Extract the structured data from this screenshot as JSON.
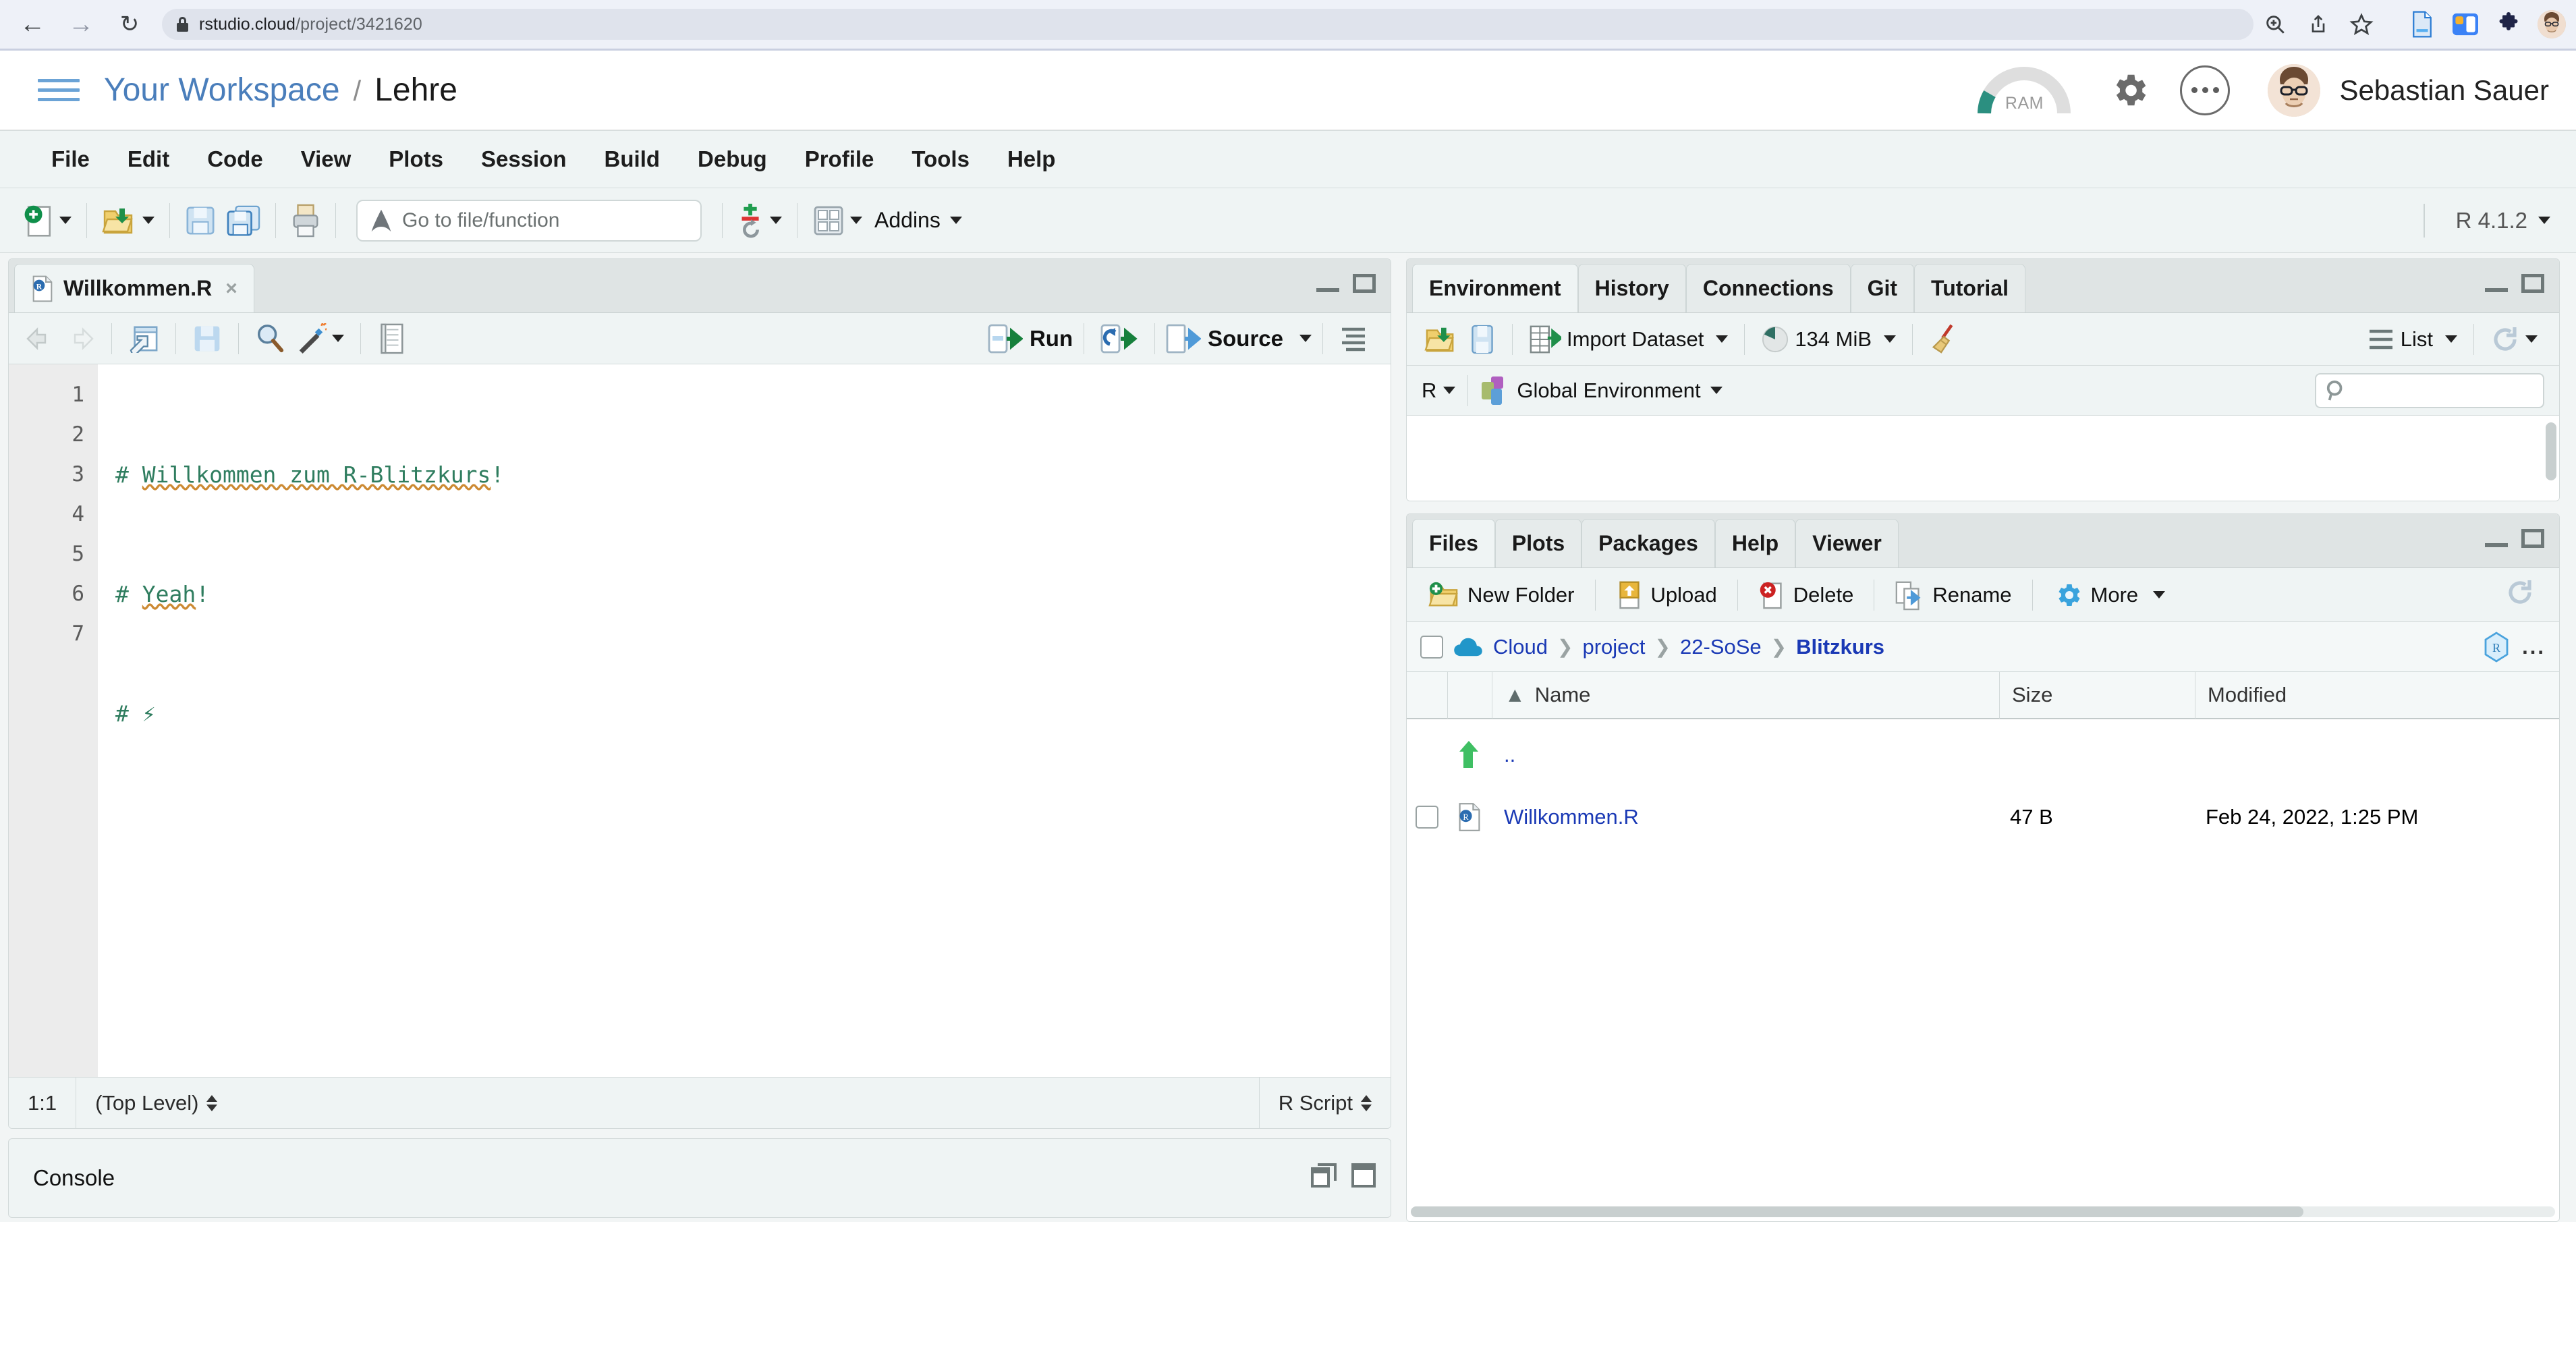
{
  "browser": {
    "url_host": "rstudio.cloud",
    "url_path": "/project/3421620",
    "back_icon": "back-arrow-icon",
    "forward_icon": "forward-arrow-icon",
    "reload_icon": "reload-icon",
    "icons": [
      "zoom-icon",
      "share-icon",
      "bookmark-star-icon",
      "reader-mode-icon",
      "side-panel-icon",
      "extensions-puzzle-icon",
      "profile-avatar-icon",
      "kebab-menu-icon"
    ]
  },
  "cloud_header": {
    "menu_icon": "hamburger-menu-icon",
    "workspace": "Your Workspace",
    "separator": "/",
    "project": "Lehre",
    "ram_label": "RAM",
    "gear_icon": "gear-icon",
    "more_icon": "ellipsis-icon",
    "user_name": "Sebastian Sauer"
  },
  "menubar": [
    "File",
    "Edit",
    "Code",
    "View",
    "Plots",
    "Session",
    "Build",
    "Debug",
    "Profile",
    "Tools",
    "Help"
  ],
  "toolbar": {
    "new_file": "new-file-icon",
    "open_file": "open-file-icon",
    "save": "save-icon",
    "save_all": "save-all-icon",
    "print": "print-icon",
    "goto_placeholder": "Go to file/function",
    "compile_report": "compile-report-icon",
    "pane_layout": "pane-layout-icon",
    "addins_label": "Addins",
    "r_version": "R 4.1.2"
  },
  "source": {
    "tab_label": "Willkommen.R",
    "tab_close": "×",
    "run_label": "Run",
    "source_label": "Source",
    "code_lines": [
      {
        "n": "1",
        "pre": "# ",
        "text": "Willkommen zum R-Blitzkurs",
        "post": "!"
      },
      {
        "n": "2",
        "pre": "# ",
        "text": "Yeah",
        "post": "!"
      },
      {
        "n": "3",
        "pre": "# ",
        "text": "⚡",
        "post": ""
      },
      {
        "n": "4",
        "pre": "",
        "text": "",
        "post": ""
      },
      {
        "n": "5",
        "pre": "",
        "text": "",
        "post": ""
      },
      {
        "n": "6",
        "pre": "",
        "text": "",
        "post": ""
      },
      {
        "n": "7",
        "pre": "",
        "text": "",
        "post": ""
      }
    ],
    "status_position": "1:1",
    "status_scope": "(Top Level)",
    "status_type": "R Script"
  },
  "console": {
    "title": "Console"
  },
  "environment": {
    "tabs": [
      "Environment",
      "History",
      "Connections",
      "Git",
      "Tutorial"
    ],
    "active_tab": "Environment",
    "import_label": "Import Dataset",
    "memory_label": "134 MiB",
    "broom_icon": "broom-icon",
    "view_label": "List",
    "refresh_icon": "refresh-icon",
    "language": "R",
    "scope": "Global Environment",
    "search_icon": "search-icon",
    "search_value": ""
  },
  "files": {
    "tabs": [
      "Files",
      "Plots",
      "Packages",
      "Help",
      "Viewer"
    ],
    "active_tab": "Files",
    "actions": [
      {
        "label": "New Folder",
        "icon": "new-folder-icon"
      },
      {
        "label": "Upload",
        "icon": "upload-icon"
      },
      {
        "label": "Delete",
        "icon": "delete-icon"
      },
      {
        "label": "Rename",
        "icon": "rename-icon"
      },
      {
        "label": "More",
        "icon": "more-gear-icon"
      }
    ],
    "path": [
      "Cloud",
      "project",
      "22-SoSe",
      "Blitzkurs"
    ],
    "path_icon": "cloud-icon",
    "project_badge": "r-project-icon",
    "overflow": "...",
    "columns": [
      "Name",
      "Size",
      "Modified"
    ],
    "sort_indicator": "▲",
    "rows": [
      {
        "name": "..",
        "size": "",
        "modified": "",
        "icon": "parent-folder-up-icon",
        "checkbox": false
      },
      {
        "name": "Willkommen.R",
        "size": "47 B",
        "modified": "Feb 24, 2022, 1:25 PM",
        "icon": "r-file-icon",
        "checkbox": true
      }
    ]
  },
  "colors": {
    "accent_blue": "#4a7ebb",
    "link_blue": "#1a39b5",
    "comment_green": "#2f7d5f",
    "spell_orange": "#cc8a33",
    "ram_teal": "#2b8f80",
    "pane_bg": "#eff4f4"
  }
}
